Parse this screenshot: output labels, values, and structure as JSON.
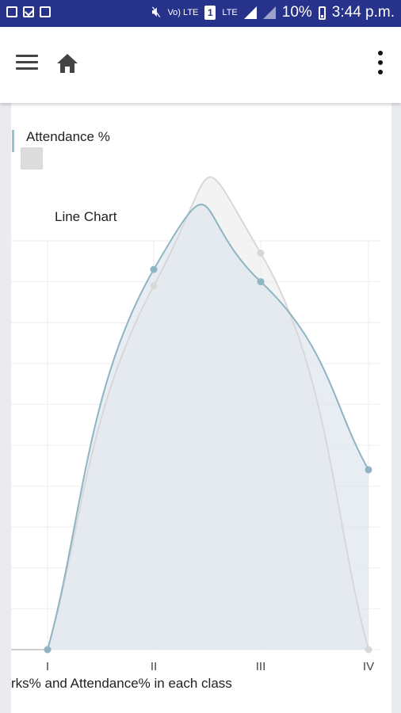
{
  "status_bar": {
    "battery": "10%",
    "time": "3:44 p.m.",
    "volte_label": "Vo)\nLTE",
    "sim_label": "1",
    "lte_label": "LTE"
  },
  "toolbar": {
    "menu_icon": "hamburger-menu-icon",
    "home_icon": "home-icon",
    "more_icon": "more-vert-icon"
  },
  "legend": {
    "label": "Attendance %",
    "swatch_color": "#dcdcdc",
    "accent_color": "#9bc0cf"
  },
  "chart_data": {
    "type": "area",
    "title": "Line Chart",
    "xlabel": "rks% and Attendance% in each class",
    "categories": [
      "I",
      "II",
      "III",
      "IV"
    ],
    "ylim": [
      0,
      100
    ],
    "grid": true,
    "series": [
      {
        "values": [
          0,
          93,
          90,
          44
        ],
        "color": "#8fb4c4",
        "fill": "#dde6ec"
      },
      {
        "name": "Attendance %",
        "values": [
          0,
          89,
          97,
          0
        ],
        "color": "#d8d8d8",
        "fill": "#eeeeee"
      }
    ]
  }
}
